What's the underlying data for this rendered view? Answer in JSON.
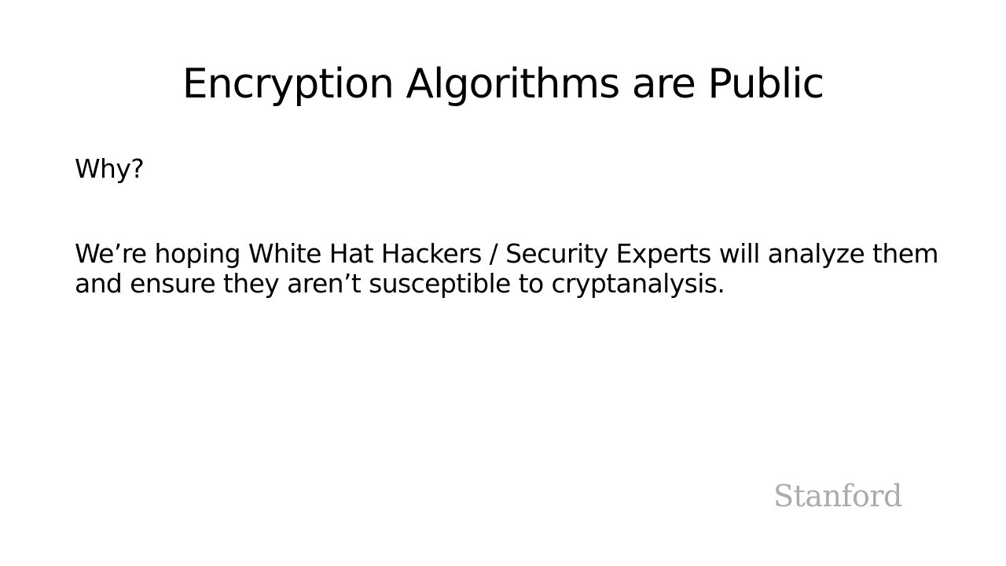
{
  "slide": {
    "title": "Encryption Algorithms are Public",
    "question": "Why?",
    "paragraph": "We’re hoping White Hat Hackers / Security Experts will analyze them and ensure they aren’t susceptible to cryptanalysis.",
    "logo_text": "Stanford"
  },
  "colors": {
    "background": "#ffffff",
    "text": "#000000",
    "logo": "#ababab"
  }
}
